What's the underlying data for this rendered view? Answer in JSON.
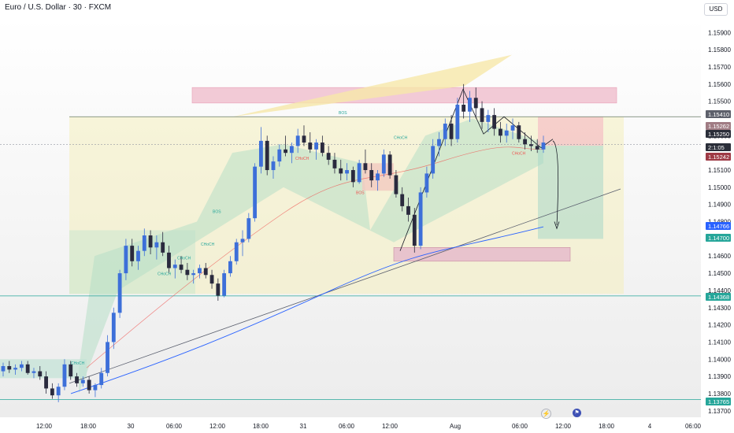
{
  "header": {
    "title": "Euro / U.S. Dollar · 30 · FXCM",
    "currency": "USD"
  },
  "colors": {
    "up": "#3d6fd9",
    "down": "#2a2a3e",
    "ma_blue": "#2962ff",
    "ma_red": "#ef5350",
    "green_zone": "#26a69a",
    "pink_zone": "#e57396"
  },
  "footer_icons": [
    "lightning-icon",
    "flag-icon"
  ],
  "chart_data": {
    "type": "candlestick",
    "price_axis_ticks": [
      "1.15900",
      "1.15800",
      "1.15700",
      "1.15600",
      "1.15500",
      "1.15300",
      "1.15100",
      "1.15000",
      "1.14900",
      "1.14800",
      "1.14600",
      "1.14500",
      "1.14400",
      "1.14300",
      "1.14200",
      "1.14100",
      "1.14000",
      "1.13900",
      "1.13800",
      "1.13700"
    ],
    "price_axis_range": [
      1.1369,
      1.1597
    ],
    "time_axis_ticks": [
      "12:00",
      "18:00",
      "30",
      "06:00",
      "12:00",
      "18:00",
      "31",
      "06:00",
      "12:00",
      "Aug",
      "06:00",
      "12:00",
      "18:00",
      "4",
      "06:00"
    ],
    "price_labels": [
      {
        "value": "1.15410",
        "bg": "#5d606b"
      },
      {
        "value": "1.15262",
        "bg": "#a07c84"
      },
      {
        "value": "1.15250",
        "bg": "#2a2e39"
      },
      {
        "value": "2:1:05",
        "bg": "#2a2e39"
      },
      {
        "value": "1.15242",
        "bg": "#9e3a45"
      },
      {
        "value": "1.14766",
        "bg": "#2962ff"
      },
      {
        "value": "1.14700",
        "bg": "#26a69a"
      },
      {
        "value": "1.14368",
        "bg": "#26a69a"
      },
      {
        "value": "1.13765",
        "bg": "#26a69a"
      }
    ],
    "annotations": [
      {
        "text": "BOS",
        "kind": "bull"
      },
      {
        "text": "BOS",
        "kind": "bull"
      },
      {
        "text": "CHoCH",
        "kind": "bull"
      },
      {
        "text": "CHoCH",
        "kind": "bull"
      },
      {
        "text": "CHoCH",
        "kind": "bull"
      },
      {
        "text": "CHoCH",
        "kind": "bull"
      },
      {
        "text": "CHoCH",
        "kind": "bull"
      },
      {
        "text": "CHoCH",
        "kind": "bear"
      },
      {
        "text": "CHoCH",
        "kind": "bear"
      },
      {
        "text": "BOS",
        "kind": "bear"
      }
    ],
    "candles": [
      [
        1.1393,
        1.1398,
        1.139,
        1.1396
      ],
      [
        1.1396,
        1.1399,
        1.1392,
        1.1394
      ],
      [
        1.1394,
        1.1397,
        1.1391,
        1.1395
      ],
      [
        1.1395,
        1.1399,
        1.1393,
        1.1397
      ],
      [
        1.1397,
        1.1399,
        1.1391,
        1.1392
      ],
      [
        1.1392,
        1.1395,
        1.1389,
        1.1393
      ],
      [
        1.1393,
        1.1396,
        1.1388,
        1.139
      ],
      [
        1.139,
        1.1393,
        1.138,
        1.1383
      ],
      [
        1.1383,
        1.1386,
        1.1377,
        1.1379
      ],
      [
        1.1379,
        1.1386,
        1.1375,
        1.1384
      ],
      [
        1.1384,
        1.14,
        1.1382,
        1.1397
      ],
      [
        1.1397,
        1.1399,
        1.1388,
        1.139
      ],
      [
        1.139,
        1.1392,
        1.1384,
        1.1386
      ],
      [
        1.1386,
        1.139,
        1.1384,
        1.1388
      ],
      [
        1.1388,
        1.139,
        1.138,
        1.1382
      ],
      [
        1.1382,
        1.1386,
        1.1378,
        1.1385
      ],
      [
        1.1385,
        1.1395,
        1.1383,
        1.1392
      ],
      [
        1.1392,
        1.1414,
        1.139,
        1.141
      ],
      [
        1.141,
        1.143,
        1.1406,
        1.1427
      ],
      [
        1.1427,
        1.1452,
        1.1424,
        1.145
      ],
      [
        1.145,
        1.147,
        1.1446,
        1.1466
      ],
      [
        1.1466,
        1.147,
        1.1454,
        1.1457
      ],
      [
        1.1457,
        1.1466,
        1.1452,
        1.1463
      ],
      [
        1.1463,
        1.1476,
        1.146,
        1.1472
      ],
      [
        1.1472,
        1.1475,
        1.1461,
        1.1465
      ],
      [
        1.1465,
        1.1472,
        1.1458,
        1.1468
      ],
      [
        1.1468,
        1.1474,
        1.146,
        1.1462
      ],
      [
        1.1462,
        1.1466,
        1.145,
        1.1453
      ],
      [
        1.1453,
        1.1458,
        1.1447,
        1.1455
      ],
      [
        1.1455,
        1.146,
        1.145,
        1.1452
      ],
      [
        1.1452,
        1.1456,
        1.1446,
        1.1449
      ],
      [
        1.1449,
        1.1452,
        1.1444,
        1.145
      ],
      [
        1.145,
        1.1455,
        1.1447,
        1.1453
      ],
      [
        1.1453,
        1.1456,
        1.1447,
        1.1449
      ],
      [
        1.1449,
        1.1452,
        1.1441,
        1.1444
      ],
      [
        1.1444,
        1.1447,
        1.1434,
        1.1437
      ],
      [
        1.1437,
        1.1452,
        1.1436,
        1.145
      ],
      [
        1.145,
        1.146,
        1.1448,
        1.1457
      ],
      [
        1.1457,
        1.147,
        1.1455,
        1.1468
      ],
      [
        1.1468,
        1.1475,
        1.146,
        1.147
      ],
      [
        1.147,
        1.1485,
        1.1468,
        1.1482
      ],
      [
        1.1482,
        1.1514,
        1.148,
        1.1512
      ],
      [
        1.1512,
        1.1535,
        1.1508,
        1.1527
      ],
      [
        1.1527,
        1.153,
        1.1507,
        1.151
      ],
      [
        1.151,
        1.1518,
        1.1505,
        1.1515
      ],
      [
        1.1515,
        1.1525,
        1.1512,
        1.1522
      ],
      [
        1.1522,
        1.153,
        1.1518,
        1.152
      ],
      [
        1.152,
        1.1526,
        1.1514,
        1.1524
      ],
      [
        1.1524,
        1.1534,
        1.152,
        1.153
      ],
      [
        1.153,
        1.1536,
        1.1524,
        1.1526
      ],
      [
        1.1526,
        1.1532,
        1.152,
        1.1522
      ],
      [
        1.1522,
        1.1528,
        1.1516,
        1.1526
      ],
      [
        1.1526,
        1.153,
        1.1518,
        1.152
      ],
      [
        1.152,
        1.1524,
        1.1513,
        1.1516
      ],
      [
        1.1516,
        1.152,
        1.1508,
        1.1511
      ],
      [
        1.1511,
        1.1516,
        1.1504,
        1.1508
      ],
      [
        1.1508,
        1.1514,
        1.1504,
        1.151
      ],
      [
        1.151,
        1.1512,
        1.15,
        1.1503
      ],
      [
        1.1503,
        1.1516,
        1.1502,
        1.1514
      ],
      [
        1.1514,
        1.1522,
        1.1508,
        1.151
      ],
      [
        1.151,
        1.1514,
        1.15,
        1.1504
      ],
      [
        1.1504,
        1.151,
        1.1498,
        1.1508
      ],
      [
        1.1508,
        1.1522,
        1.1506,
        1.1519
      ],
      [
        1.1519,
        1.1521,
        1.1505,
        1.1507
      ],
      [
        1.1507,
        1.151,
        1.1494,
        1.1496
      ],
      [
        1.1496,
        1.15,
        1.1486,
        1.1489
      ],
      [
        1.1489,
        1.1494,
        1.148,
        1.1484
      ],
      [
        1.1484,
        1.1488,
        1.1462,
        1.1466
      ],
      [
        1.1466,
        1.15,
        1.1464,
        1.1497
      ],
      [
        1.1497,
        1.1512,
        1.1494,
        1.1508
      ],
      [
        1.1508,
        1.1528,
        1.1505,
        1.1524
      ],
      [
        1.1524,
        1.1532,
        1.1518,
        1.1528
      ],
      [
        1.1528,
        1.154,
        1.1524,
        1.1537
      ],
      [
        1.1537,
        1.1542,
        1.1524,
        1.1528
      ],
      [
        1.1528,
        1.1552,
        1.1526,
        1.1548
      ],
      [
        1.1548,
        1.156,
        1.154,
        1.1544
      ],
      [
        1.1544,
        1.1556,
        1.1538,
        1.1552
      ],
      [
        1.1552,
        1.1558,
        1.154,
        1.1546
      ],
      [
        1.1546,
        1.155,
        1.1534,
        1.1538
      ],
      [
        1.1538,
        1.1545,
        1.1532,
        1.1542
      ],
      [
        1.1542,
        1.1546,
        1.153,
        1.1534
      ],
      [
        1.1534,
        1.1538,
        1.1526,
        1.153
      ],
      [
        1.153,
        1.1537,
        1.1526,
        1.1533
      ],
      [
        1.1533,
        1.154,
        1.1528,
        1.1536
      ],
      [
        1.1536,
        1.1538,
        1.1526,
        1.1528
      ],
      [
        1.1528,
        1.1532,
        1.1522,
        1.1525
      ],
      [
        1.1525,
        1.153,
        1.1521,
        1.1524
      ],
      [
        1.1524,
        1.1528,
        1.152,
        1.1522
      ],
      [
        1.1522,
        1.153,
        1.152,
        1.1526
      ]
    ]
  }
}
